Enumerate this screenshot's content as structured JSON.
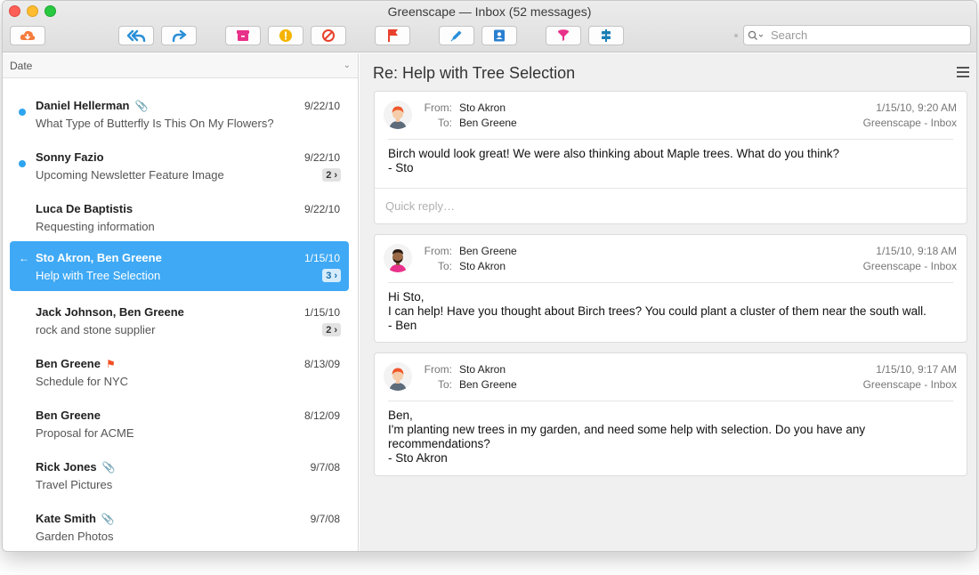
{
  "window": {
    "title": "Greenscape — Inbox (52 messages)"
  },
  "search": {
    "placeholder": "Search"
  },
  "sidebar": {
    "sort_label": "Date",
    "messages": [
      {
        "sender": "Daniel Hellerman",
        "subject": "What Type of Butterfly Is This On My Flowers?",
        "date": "9/22/10",
        "unread": true,
        "attachment": true
      },
      {
        "sender": "Sonny Fazio",
        "subject": "Upcoming Newsletter Feature Image",
        "date": "9/22/10",
        "unread": true,
        "count": "2"
      },
      {
        "sender": "Luca De Baptistis",
        "subject": "Requesting information",
        "date": "9/22/10"
      },
      {
        "sender": "Sto Akron, Ben Greene",
        "subject": "Help with Tree Selection",
        "date": "1/15/10",
        "selected": true,
        "count": "3"
      },
      {
        "sender": "Jack Johnson, Ben Greene",
        "subject": "rock and stone supplier",
        "date": "1/15/10",
        "count": "2"
      },
      {
        "sender": "Ben Greene",
        "subject": "Schedule for NYC",
        "date": "8/13/09",
        "flagged": true
      },
      {
        "sender": "Ben Greene",
        "subject": "Proposal for ACME",
        "date": "8/12/09"
      },
      {
        "sender": "Rick Jones",
        "subject": "Travel Pictures",
        "date": "9/7/08",
        "attachment": true
      },
      {
        "sender": "Kate Smith",
        "subject": "Garden Photos",
        "date": "9/7/08",
        "attachment": true
      }
    ]
  },
  "reader": {
    "title": "Re: Help with Tree Selection",
    "labels": {
      "from": "From:",
      "to": "To:"
    },
    "quick_reply_placeholder": "Quick reply…",
    "messages": [
      {
        "from": "Sto Akron",
        "to": "Ben Greene",
        "datetime": "1/15/10, 9:20 AM",
        "mailbox": "Greenscape - Inbox",
        "body": "Birch would look great!  We were also thinking about Maple trees.  What do you think?\n- Sto"
      },
      {
        "from": "Ben Greene",
        "to": "Sto Akron",
        "datetime": "1/15/10, 9:18 AM",
        "mailbox": "Greenscape - Inbox",
        "body": "Hi Sto,\nI can help!  Have you thought about Birch trees?  You could plant a cluster of them near the south wall.\n- Ben"
      },
      {
        "from": "Sto Akron",
        "to": "Ben Greene",
        "datetime": "1/15/10, 9:17 AM",
        "mailbox": "Greenscape - Inbox",
        "body": "Ben,\nI'm planting new trees in my garden, and need some help with selection.  Do you have any\nrecommendations?\n- Sto Akron"
      }
    ]
  },
  "colors": {
    "accent": "#3fa9f5",
    "unread_dot": "#2ea5f0",
    "flag": "#f04e23"
  },
  "icons": {
    "toolbar": [
      "get-mail-icon",
      "reply-all-icon",
      "forward-icon",
      "archive-icon",
      "junk-icon",
      "block-icon",
      "flag-icon",
      "compose-icon",
      "contacts-icon",
      "filter-icon",
      "rules-icon"
    ]
  }
}
